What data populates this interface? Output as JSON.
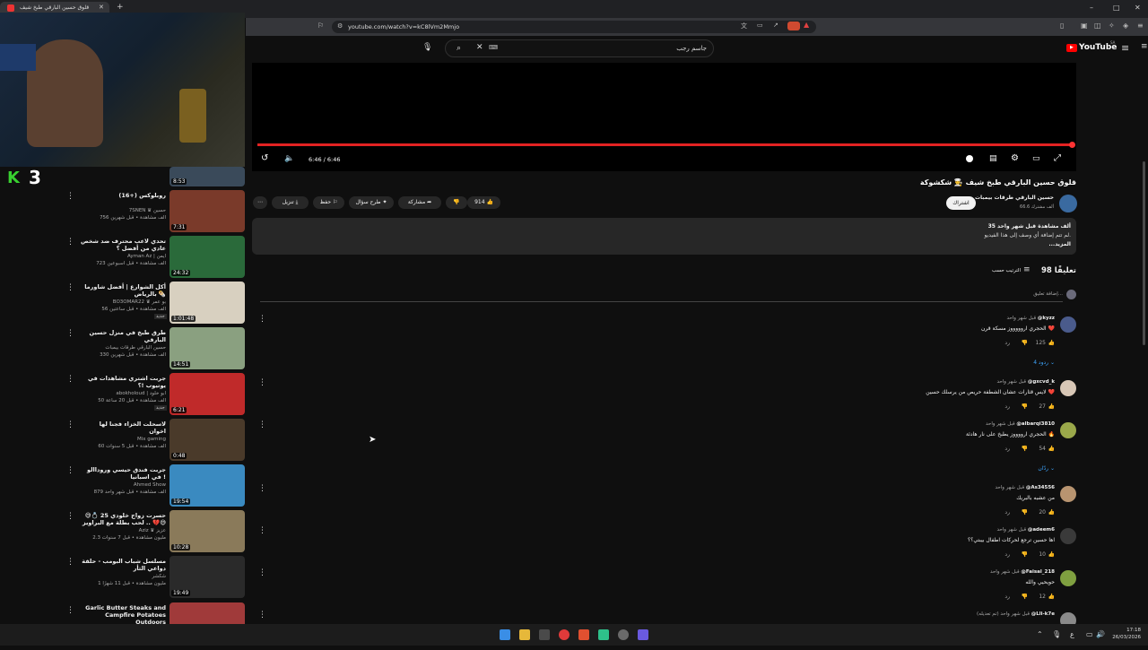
{
  "browser": {
    "tab_title": "قلوق حسين البارقي طبخ شيف",
    "url": "youtube.com/watch?v=kC8lVm2Mmjo",
    "window_min": "–",
    "window_max": "□",
    "window_close": "✕"
  },
  "youtube": {
    "logo": "YouTube",
    "logo_region": "SA",
    "search_query": "جاسم رجب"
  },
  "player": {
    "time": "6:46 / 6:46"
  },
  "video": {
    "title": "قلوق حسين البارقي طبخ شيف 👨‍🍳 شكشوكة",
    "channel": "حسين البارقي طرقات بيمبات",
    "subscribers": "66.6 ألف مشترك",
    "subscribe_label": "اشتراك",
    "likes": "914",
    "share_label": "مشاركة",
    "ask_label": "طرح سؤال",
    "save_label": "حفظ",
    "download_label": "تنزيل",
    "more_label": "⋯",
    "description_views": "35 ألف مشاهدة قبل شهر واحد",
    "description_text": "لم تتم إضافة أي وصف إلى هذا الفيديو.",
    "description_more": "...المزيد"
  },
  "comments": {
    "count_label": "98 تعليقًا",
    "sort_label": "الترتيب حسب",
    "add_placeholder": "إضافة تعليق...",
    "items": [
      {
        "author": "@kyzz",
        "time": "قبل شهر واحد",
        "text": "الحجري اروووووز مسكة قرن ❤️",
        "likes": "125",
        "reply": "رد",
        "replies": "4 ردود",
        "avatar_color": "#4a5b8c"
      },
      {
        "author": "@gxcvd_k",
        "time": "قبل شهر واحد",
        "text": "لايس قثارات عشان الشطفة حريص من يرسلك حسين ❤️",
        "likes": "27",
        "reply": "رد",
        "replies": "",
        "avatar_color": "#d8c7b6"
      },
      {
        "author": "@albarqi3810",
        "time": "قبل شهر واحد",
        "text": "الحجري ارووووز يطبخ على نار هادئة 🔥",
        "likes": "54",
        "reply": "رد",
        "replies": "ردّان",
        "avatar_color": "#9aa84a"
      },
      {
        "author": "@As34556",
        "time": "قبل شهر واحد",
        "text": "من عشبه بالبريك",
        "likes": "20",
        "reply": "رد",
        "replies": "",
        "avatar_color": "#b89470"
      },
      {
        "author": "@adeem6",
        "time": "قبل شهر واحد",
        "text": "اها حسين ترجع لحركات اطفال بيبتي؟؟",
        "likes": "10",
        "reply": "رد",
        "replies": "",
        "avatar_color": "#3a3a3a"
      },
      {
        "author": "@Faisal_218",
        "time": "قبل شهر واحد",
        "text": "حويحيي والله",
        "likes": "12",
        "reply": "رد",
        "replies": "",
        "avatar_color": "#7fa040"
      },
      {
        "author": "@Lli-k7e",
        "time": "قبل شهر واحد (تم تعديله)",
        "text": "",
        "likes": "",
        "reply": "",
        "replies": "",
        "avatar_color": "#8a8a8a"
      }
    ]
  },
  "sidebar": {
    "items": [
      {
        "title": "",
        "channel": "",
        "meta": "",
        "duration": "8:53",
        "color": "#3a4a5a"
      },
      {
        "title": "روبلوكس (+16)",
        "channel": "7SNEN ♛ حسين",
        "meta": "756 ألف مشاهدة • قبل شهرين",
        "duration": "7:31",
        "color": "#7a3a2a"
      },
      {
        "title": "تحدي لاعب محترف ضد شخص عادي من أفضل ؟",
        "channel": "Ayman Az | ايمن",
        "meta": "723 ألف مشاهدة • قبل أسبوعين",
        "duration": "24:32",
        "color": "#2a6a3a"
      },
      {
        "title": "أكل الشوارع | أفضل شاورما بالرياض 🌯",
        "channel": "BO3OMAR22 ♛ بو عمر",
        "meta": "56 ألف مشاهدة • قبل ساعتين",
        "duration": "1:01:48",
        "color": "#d8d0c0",
        "badge": "جديد"
      },
      {
        "title": "طرق طبخ في منزل حسين البارقي",
        "channel": "حسين البارقي طرقات بيمبات",
        "meta": "330 ألف مشاهدة • قبل شهرين",
        "duration": "14:51",
        "color": "#8aa080"
      },
      {
        "title": "جربت اشتري مشاهدات في يوتيوب !؟",
        "channel": "abokholoud | ابو خلود",
        "meta": "50 ألف مشاهدة • قبل 20 ساعة",
        "duration": "6:21",
        "color": "#c02a2a",
        "badge": "جديد"
      },
      {
        "title": "لاسحلت الخزاء فجنا لها اخوان",
        "channel": "Mix gaming",
        "meta": "60 ألف مشاهدة • قبل 5 سنوات",
        "duration": "0:48",
        "color": "#4a3a2a"
      },
      {
        "title": "جربت فندق حيسي وروداالو في اسبانيا !",
        "channel": "Ahmed Show",
        "meta": "879 ألف مشاهدة • قبل شهر واحد",
        "duration": "19:54",
        "color": "#3a8ac0"
      },
      {
        "title": "حسرت زواج خلودي 25 💍😅 .. لحب بطلة مع البراويز 💔😅",
        "channel": "Aziz ♛ عزيز",
        "meta": "2.3 مليون مشاهدة • قبل 7 سنوات",
        "duration": "10:28",
        "color": "#8a7a5a"
      },
      {
        "title": "مسلسل شباب البومب - حلقة دواعي الثأر",
        "channel": "شكشر",
        "meta": "1 مليون مشاهدة • قبل 11 شهرًا",
        "duration": "19:49",
        "color": "#2a2a2a"
      },
      {
        "title": "Garlic Butter Steaks and Campfire Potatoes Outdoors",
        "channel": "",
        "meta": "",
        "duration": "",
        "color": "#a03a3a"
      }
    ]
  },
  "overlay": {
    "score": "3"
  },
  "taskbar": {
    "lang": "ع",
    "time": "17:18",
    "date": "26/03/2026"
  }
}
